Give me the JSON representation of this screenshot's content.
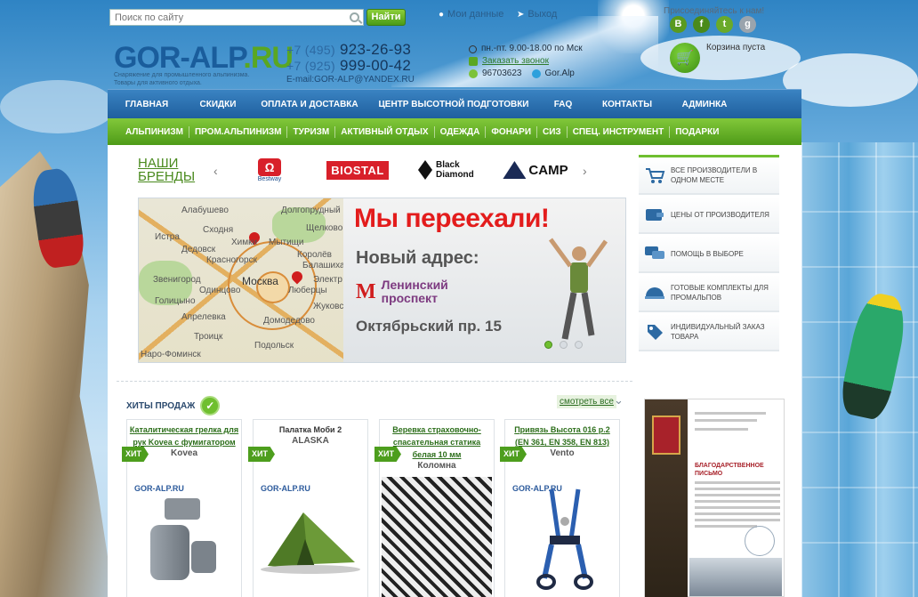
{
  "header": {
    "search_placeholder": "Поиск по сайту",
    "search_button": "Найти",
    "my_data": "Мои данные",
    "logout": "Выход",
    "social_title": "Присоединяйтесь к нам!",
    "logo_main": "GOR-ALP",
    "logo_suffix": ".RU",
    "tagline": "Снаряжение для промышленного альпинизма. Товары для активного отдыха.",
    "phone1_code": "+7 (495)",
    "phone1_num": "923-26-93",
    "phone2_code": "+7 (925)",
    "phone2_num": "999-00-42",
    "email": "E-mail:GOR-ALP@YANDEX.RU",
    "hours": "пн.-пт. 9.00-18.00 по Мск",
    "callback": "Заказать звонок",
    "icq": "96703623",
    "skype": "Gor.Alp",
    "cart": "Корзина пуста",
    "social": [
      "В",
      "f",
      "t",
      "g"
    ]
  },
  "nav_main": [
    "ГЛАВНАЯ",
    "СКИДКИ",
    "ОПЛАТА И ДОСТАВКА",
    "ЦЕНТР ВЫСОТНОЙ ПОДГОТОВКИ",
    "FAQ",
    "КОНТАКТЫ",
    "АДМИНКА"
  ],
  "nav_cat": [
    "АЛЬПИНИЗМ",
    "ПРОМ.АЛЬПИНИЗМ",
    "ТУРИЗМ",
    "АКТИВНЫЙ ОТДЫХ",
    "ОДЕЖДА",
    "ФОНАРИ",
    "СИЗ",
    "СПЕЦ. ИНСТРУМЕНТ",
    "ПОДАРКИ"
  ],
  "brands": {
    "title_line1": "НАШИ",
    "title_line2": "БРЕНДЫ",
    "items": [
      "Bestway",
      "BIOSTAL",
      "Black Diamond",
      "CAMP"
    ]
  },
  "banner": {
    "headline": "Мы переехали!",
    "subline": "Новый адрес:",
    "metro_letter": "М",
    "metro1": "Ленинский",
    "metro2": "проспект",
    "address": "Октябрьский пр. 15",
    "map_labels": [
      "Алабушево",
      "Долгопрудный",
      "Истра",
      "Сходня",
      "Химки",
      "Мытищи",
      "Щелково",
      "Дедовск",
      "Красногорск",
      "Королёв",
      "Балашиха",
      "Звенигород",
      "Москва",
      "Люберцы",
      "Одинцово",
      "Апрелевка",
      "Голицыно",
      "Домодедово",
      "Троицк",
      "Подольск",
      "Наро-Фоминск",
      "Электр",
      "Жуковский"
    ],
    "slides": 3,
    "active_slide": 1
  },
  "features": [
    "ВСЕ ПРОИЗВОДИТЕЛИ В ОДНОМ МЕСТЕ",
    "ЦЕНЫ ОТ ПРОИЗВОДИТЕЛЯ",
    "ПОМОЩЬ В ВЫБОРЕ",
    "ГОТОВЫЕ КОМПЛЕКТЫ ДЛЯ ПРОМАЛЬПОВ",
    "ИНДИВИДУАЛЬНЫЙ ЗАКАЗ ТОВАРА"
  ],
  "hits": {
    "title": "ХИТЫ ПРОДАЖ",
    "see_all": "смотреть все",
    "badge": "ХИТ",
    "products": [
      {
        "name": "Каталитическая грелка для рук Kovea с фумигатором",
        "brand": "Kovea"
      },
      {
        "name": "Палатка Моби 2",
        "brand": "ALASKA"
      },
      {
        "name": "Веревка страховочно-спасательная статика белая 10 мм",
        "brand": "Коломна"
      },
      {
        "name": "Привязь Высота 016 р.2 (EN 361, EN 358, EN 813)",
        "brand": "Vento"
      }
    ],
    "mini_logo": "GOR-ALP.RU"
  },
  "letter": {
    "title": "БЛАГОДАРСТВЕННОЕ ПИСЬМО"
  }
}
